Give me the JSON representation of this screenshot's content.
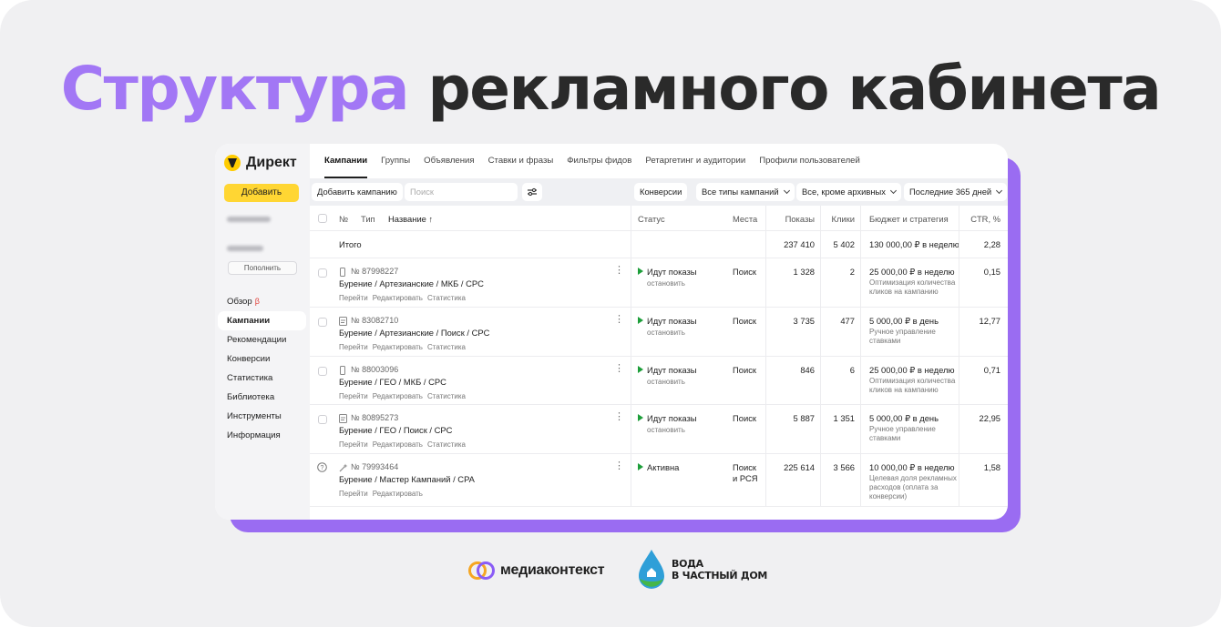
{
  "headline": {
    "accent": "Структура",
    "rest": "рекламного кабинета"
  },
  "colors": {
    "accent": "#a277f5",
    "frame": "#9a6cf2",
    "add_button": "#ffd633",
    "status_green": "#1d9e3a"
  },
  "sidebar": {
    "logo": "Директ",
    "add_button": "Добавить",
    "topup_button": "Пополнить",
    "items": [
      {
        "label": "Обзор",
        "badge": "β",
        "active": false
      },
      {
        "label": "Кампании",
        "active": true
      },
      {
        "label": "Рекомендации",
        "active": false
      },
      {
        "label": "Конверсии",
        "active": false
      },
      {
        "label": "Статистика",
        "active": false
      },
      {
        "label": "Библиотека",
        "active": false
      },
      {
        "label": "Инструменты",
        "active": false
      },
      {
        "label": "Информация",
        "active": false
      }
    ]
  },
  "tabs": [
    "Кампании",
    "Группы",
    "Объявления",
    "Ставки и фразы",
    "Фильтры фидов",
    "Ретаргетинг и аудитории",
    "Профили пользователей"
  ],
  "toolbar": {
    "add_campaign": "Добавить кампанию",
    "search_placeholder": "Поиск",
    "conversions": "Конверсии",
    "campaign_types": "Все типы кампаний",
    "archive_filter": "Все, кроме архивных",
    "period": "Последние 365 дней"
  },
  "table": {
    "headers": {
      "no": "№",
      "type": "Тип",
      "name": "Название ↑",
      "status": "Статус",
      "places": "Места",
      "shows": "Показы",
      "clicks": "Клики",
      "budget": "Бюджет и стратегия",
      "ctr": "CTR, %"
    },
    "total": {
      "label": "Итого",
      "shows": "237 410",
      "clicks": "5 402",
      "budget": "130 000,00 ₽ в неделю",
      "ctr": "2,28"
    },
    "rows": [
      {
        "id": "№ 87998227",
        "name": "Бурение / Артезианские / МКБ / CPC",
        "links": [
          "Перейти",
          "Редактировать",
          "Статистика"
        ],
        "status": "Идут показы",
        "status_action": "остановить",
        "places": "Поиск",
        "shows": "1 328",
        "clicks": "2",
        "budget": "25 000,00 ₽ в неделю",
        "strategy": "Оптимизация количества кликов на кампанию",
        "ctr": "0,15",
        "type_icon": "mobile-icon"
      },
      {
        "id": "№ 83082710",
        "name": "Бурение / Артезианские / Поиск / CPC",
        "links": [
          "Перейти",
          "Редактировать",
          "Статистика"
        ],
        "status": "Идут показы",
        "status_action": "остановить",
        "places": "Поиск",
        "shows": "3 735",
        "clicks": "477",
        "budget": "5 000,00 ₽ в день",
        "strategy": "Ручное управление ставками",
        "ctr": "12,77",
        "type_icon": "text-ad-icon"
      },
      {
        "id": "№ 88003096",
        "name": "Бурение / ГЕО / МКБ / CPC",
        "links": [
          "Перейти",
          "Редактировать",
          "Статистика"
        ],
        "status": "Идут показы",
        "status_action": "остановить",
        "places": "Поиск",
        "shows": "846",
        "clicks": "6",
        "budget": "25 000,00 ₽ в неделю",
        "strategy": "Оптимизация количества кликов на кампанию",
        "ctr": "0,71",
        "type_icon": "mobile-icon"
      },
      {
        "id": "№ 80895273",
        "name": "Бурение / ГЕО / Поиск / CPC",
        "links": [
          "Перейти",
          "Редактировать",
          "Статистика"
        ],
        "status": "Идут показы",
        "status_action": "остановить",
        "places": "Поиск",
        "shows": "5 887",
        "clicks": "1 351",
        "budget": "5 000,00 ₽ в день",
        "strategy": "Ручное управление ставками",
        "ctr": "22,95",
        "type_icon": "text-ad-icon"
      },
      {
        "id": "№ 79993464",
        "name": "Бурение / Мастер Кампаний / CPA",
        "links": [
          "Перейти",
          "Редактировать"
        ],
        "status": "Активна",
        "status_action": "",
        "places": "Поиск и РСЯ",
        "shows": "225 614",
        "clicks": "3 566",
        "budget": "10 000,00 ₽ в неделю",
        "strategy": "Целевая доля рекламных расходов (оплата за конверсии)",
        "ctr": "1,58",
        "type_icon": "wand-icon"
      }
    ]
  },
  "footer": {
    "brand1": "медиаконтекст",
    "brand2_line1": "ВОДА",
    "brand2_line2": "В ЧАСТНЫЙ ДОМ"
  }
}
